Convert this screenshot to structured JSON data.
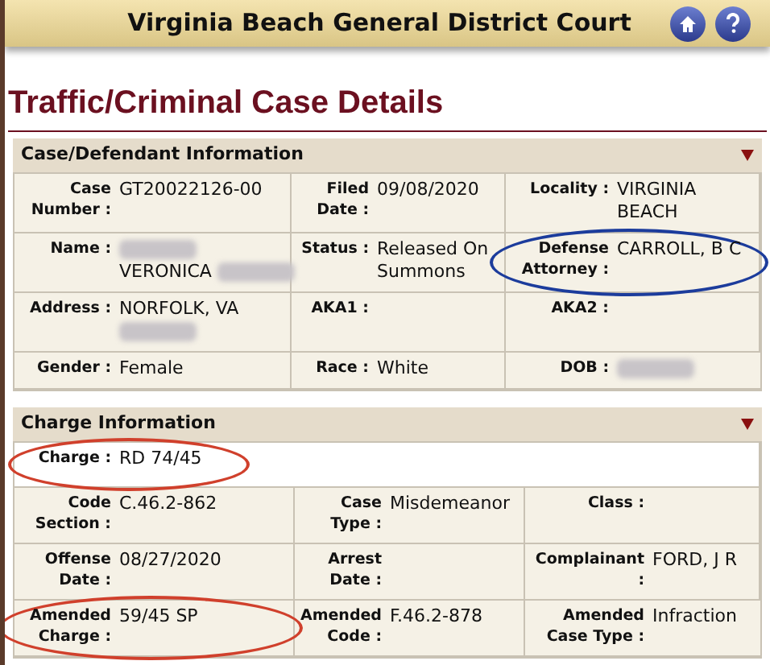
{
  "header": {
    "title": "Virginia Beach General District Court"
  },
  "page_title": "Traffic/Criminal Case Details",
  "sections": [
    {
      "title": "Case/Defendant Information",
      "rows": [
        [
          {
            "label": "Case Number :",
            "value": "GT20022126-00"
          },
          {
            "label": "Filed Date :",
            "value": "09/08/2020"
          },
          {
            "label": "Locality :",
            "value": "VIRGINIA BEACH"
          }
        ],
        [
          {
            "label": "Name :",
            "lines": [
              [
                {
                  "kind": "redacted"
                }
              ],
              [
                {
                  "kind": "text",
                  "text": "VERONICA"
                },
                {
                  "kind": "redacted"
                }
              ]
            ]
          },
          {
            "label": "Status :",
            "value": "Released On Summons"
          },
          {
            "label": "Defense Attorney :",
            "value": "CARROLL, B C",
            "circle": {
              "color": "#1c3c9c"
            }
          }
        ],
        [
          {
            "label": "Address :",
            "lines": [
              [
                {
                  "kind": "text",
                  "text": "NORFOLK, VA"
                }
              ],
              [
                {
                  "kind": "redacted"
                }
              ]
            ]
          },
          {
            "label": "AKA1 :"
          },
          {
            "label": "AKA2 :"
          }
        ],
        [
          {
            "label": "Gender :",
            "value": "Female"
          },
          {
            "label": "Race :",
            "value": "White"
          },
          {
            "label": "DOB :",
            "lines": [
              [
                {
                  "kind": "redacted"
                }
              ]
            ]
          }
        ]
      ]
    },
    {
      "title": "Charge Information",
      "rows": [
        [
          {
            "label": "Charge :",
            "value": "RD 74/45",
            "circle": {
              "color": "#d0402c"
            }
          }
        ],
        [
          {
            "label": "Code Section :",
            "value": "C.46.2-862"
          },
          {
            "label": "Case Type :",
            "value": "Misdemeanor"
          },
          {
            "label": "Class :"
          }
        ],
        [
          {
            "label": "Offense Date :",
            "value": "08/27/2020"
          },
          {
            "label": "Arrest Date :"
          },
          {
            "label": "Complainant :",
            "value": "FORD, J R"
          }
        ],
        [
          {
            "label": "Amended Charge :",
            "value": "59/45 SP",
            "circle": {
              "color": "#d0402c"
            }
          },
          {
            "label": "Amended Code :",
            "value": "F.46.2-878"
          },
          {
            "label": "Amended Case Type :",
            "value": "Infraction"
          }
        ]
      ]
    }
  ]
}
